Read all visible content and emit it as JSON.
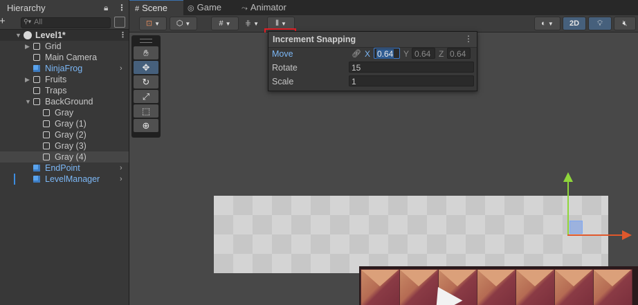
{
  "hierarchy": {
    "tab_label": "Hierarchy",
    "search_placeholder": "All",
    "rows": [
      {
        "label": "Level1*"
      },
      {
        "label": "Grid"
      },
      {
        "label": "Main Camera"
      },
      {
        "label": "NinjaFrog"
      },
      {
        "label": "Fruits"
      },
      {
        "label": "Traps"
      },
      {
        "label": "BackGround"
      },
      {
        "label": "Gray"
      },
      {
        "label": "Gray (1)"
      },
      {
        "label": "Gray (2)"
      },
      {
        "label": "Gray (3)"
      },
      {
        "label": "Gray (4)"
      },
      {
        "label": "EndPoint"
      },
      {
        "label": "LevelManager"
      }
    ]
  },
  "scene": {
    "tabs": [
      {
        "label": "Scene"
      },
      {
        "label": "Game"
      },
      {
        "label": "Animator"
      }
    ],
    "toolbar": {
      "mode_2d_label": "2D"
    }
  },
  "increment_snapping": {
    "title": "Increment Snapping",
    "move_label": "Move",
    "rotate_label": "Rotate",
    "scale_label": "Scale",
    "axis_x": "X",
    "axis_y": "Y",
    "axis_z": "Z",
    "move_x": "0.64",
    "move_y": "0.64",
    "move_z": "0.64",
    "rotate_value": "15",
    "scale_value": "1"
  },
  "colors": {
    "prefab_blue": "#7cb7f5",
    "highlight_red": "#e21f26",
    "gizmo_y": "#8fd63a",
    "gizmo_x": "#e0582c",
    "active_tool": "#46607c"
  }
}
